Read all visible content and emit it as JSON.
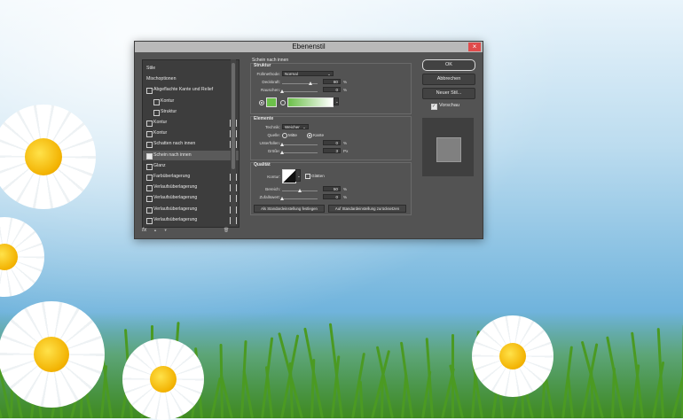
{
  "dialog": {
    "title": "Ebenenstil",
    "close_glyph": "×"
  },
  "style_list": {
    "items": [
      {
        "label": "Stile",
        "checkbox": false,
        "checked": false,
        "indent": 0,
        "plus": false,
        "selected": false
      },
      {
        "label": "Mischoptionen",
        "checkbox": false,
        "checked": false,
        "indent": 0,
        "plus": false,
        "selected": false
      },
      {
        "label": "Abgeflachte Kante und Relief",
        "checkbox": true,
        "checked": false,
        "indent": 0,
        "plus": false,
        "selected": false
      },
      {
        "label": "Kontur",
        "checkbox": true,
        "checked": false,
        "indent": 1,
        "plus": false,
        "selected": false
      },
      {
        "label": "Struktur",
        "checkbox": true,
        "checked": false,
        "indent": 1,
        "plus": false,
        "selected": false
      },
      {
        "label": "Kontur",
        "checkbox": true,
        "checked": false,
        "indent": 0,
        "plus": true,
        "selected": false
      },
      {
        "label": "Kontur",
        "checkbox": true,
        "checked": false,
        "indent": 0,
        "plus": true,
        "selected": false
      },
      {
        "label": "Schatten nach innen",
        "checkbox": true,
        "checked": false,
        "indent": 0,
        "plus": true,
        "selected": false
      },
      {
        "label": "Schein nach innen",
        "checkbox": true,
        "checked": true,
        "indent": 0,
        "plus": false,
        "selected": true
      },
      {
        "label": "Glanz",
        "checkbox": true,
        "checked": false,
        "indent": 0,
        "plus": false,
        "selected": false
      },
      {
        "label": "Farbüberlagerung",
        "checkbox": true,
        "checked": false,
        "indent": 0,
        "plus": true,
        "selected": false
      },
      {
        "label": "Verlaufsüberlagerung",
        "checkbox": true,
        "checked": false,
        "indent": 0,
        "plus": true,
        "selected": false
      },
      {
        "label": "Verlaufsüberlagerung",
        "checkbox": true,
        "checked": false,
        "indent": 0,
        "plus": true,
        "selected": false
      },
      {
        "label": "Verlaufsüberlagerung",
        "checkbox": true,
        "checked": false,
        "indent": 0,
        "plus": true,
        "selected": false
      },
      {
        "label": "Verlaufsüberlagerung",
        "checkbox": true,
        "checked": false,
        "indent": 0,
        "plus": true,
        "selected": false
      }
    ],
    "plus_glyph": "+",
    "footer": {
      "fx": "fx",
      "up": "▲",
      "down": "▼",
      "trash": "🗑"
    }
  },
  "panel": {
    "heading": "Schein nach innen",
    "struktur": {
      "title": "Struktur",
      "blend_label": "Füllmethode:",
      "blend_value": "Normal",
      "opacity_label": "Deckkraft:",
      "opacity_value": "80",
      "opacity_unit": "%",
      "opacity_fraction": 0.8,
      "noise_label": "Rauschen:",
      "noise_value": "0",
      "noise_unit": "%",
      "noise_fraction": 0.0,
      "color": "#6cc04a",
      "gradient_start": "#6cc04a",
      "gradient_end": "#ffffff"
    },
    "elemente": {
      "title": "Elemente",
      "technique_label": "Technik:",
      "technique_value": "Weicher",
      "source_label": "Quelle:",
      "source_center": "Mitte",
      "source_edge": "Kante",
      "choke_label": "Unterfüllen:",
      "choke_value": "0",
      "choke_unit": "%",
      "choke_fraction": 0.0,
      "size_label": "Größe:",
      "size_value": "3",
      "size_unit": "Px",
      "size_fraction": 0.02
    },
    "qualitaet": {
      "title": "Qualität",
      "contour_label": "Kontur:",
      "antialias_label": "Glätten",
      "range_label": "Bereich:",
      "range_value": "50",
      "range_unit": "%",
      "range_fraction": 0.5,
      "jitter_label": "Zufallswert:",
      "jitter_value": "0",
      "jitter_unit": "%",
      "jitter_fraction": 0.0
    },
    "btn_make_default": "Als Standardeinstellung festlegen",
    "btn_reset_default": "Auf Standardeinstellung zurücksetzen"
  },
  "right": {
    "ok": "OK",
    "cancel": "Abbrechen",
    "new_style": "Neuer Stil...",
    "preview_label": "Vorschau",
    "preview_checked": true
  }
}
